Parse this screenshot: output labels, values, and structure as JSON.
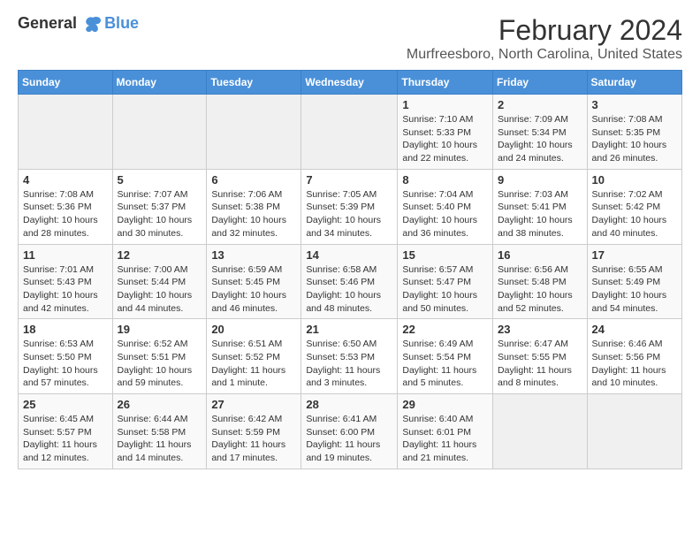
{
  "logo": {
    "line1": "General",
    "line2": "Blue"
  },
  "title": "February 2024",
  "subtitle": "Murfreesboro, North Carolina, United States",
  "days_header": [
    "Sunday",
    "Monday",
    "Tuesday",
    "Wednesday",
    "Thursday",
    "Friday",
    "Saturday"
  ],
  "weeks": [
    [
      {
        "day": "",
        "detail": ""
      },
      {
        "day": "",
        "detail": ""
      },
      {
        "day": "",
        "detail": ""
      },
      {
        "day": "",
        "detail": ""
      },
      {
        "day": "1",
        "detail": "Sunrise: 7:10 AM\nSunset: 5:33 PM\nDaylight: 10 hours\nand 22 minutes."
      },
      {
        "day": "2",
        "detail": "Sunrise: 7:09 AM\nSunset: 5:34 PM\nDaylight: 10 hours\nand 24 minutes."
      },
      {
        "day": "3",
        "detail": "Sunrise: 7:08 AM\nSunset: 5:35 PM\nDaylight: 10 hours\nand 26 minutes."
      }
    ],
    [
      {
        "day": "4",
        "detail": "Sunrise: 7:08 AM\nSunset: 5:36 PM\nDaylight: 10 hours\nand 28 minutes."
      },
      {
        "day": "5",
        "detail": "Sunrise: 7:07 AM\nSunset: 5:37 PM\nDaylight: 10 hours\nand 30 minutes."
      },
      {
        "day": "6",
        "detail": "Sunrise: 7:06 AM\nSunset: 5:38 PM\nDaylight: 10 hours\nand 32 minutes."
      },
      {
        "day": "7",
        "detail": "Sunrise: 7:05 AM\nSunset: 5:39 PM\nDaylight: 10 hours\nand 34 minutes."
      },
      {
        "day": "8",
        "detail": "Sunrise: 7:04 AM\nSunset: 5:40 PM\nDaylight: 10 hours\nand 36 minutes."
      },
      {
        "day": "9",
        "detail": "Sunrise: 7:03 AM\nSunset: 5:41 PM\nDaylight: 10 hours\nand 38 minutes."
      },
      {
        "day": "10",
        "detail": "Sunrise: 7:02 AM\nSunset: 5:42 PM\nDaylight: 10 hours\nand 40 minutes."
      }
    ],
    [
      {
        "day": "11",
        "detail": "Sunrise: 7:01 AM\nSunset: 5:43 PM\nDaylight: 10 hours\nand 42 minutes."
      },
      {
        "day": "12",
        "detail": "Sunrise: 7:00 AM\nSunset: 5:44 PM\nDaylight: 10 hours\nand 44 minutes."
      },
      {
        "day": "13",
        "detail": "Sunrise: 6:59 AM\nSunset: 5:45 PM\nDaylight: 10 hours\nand 46 minutes."
      },
      {
        "day": "14",
        "detail": "Sunrise: 6:58 AM\nSunset: 5:46 PM\nDaylight: 10 hours\nand 48 minutes."
      },
      {
        "day": "15",
        "detail": "Sunrise: 6:57 AM\nSunset: 5:47 PM\nDaylight: 10 hours\nand 50 minutes."
      },
      {
        "day": "16",
        "detail": "Sunrise: 6:56 AM\nSunset: 5:48 PM\nDaylight: 10 hours\nand 52 minutes."
      },
      {
        "day": "17",
        "detail": "Sunrise: 6:55 AM\nSunset: 5:49 PM\nDaylight: 10 hours\nand 54 minutes."
      }
    ],
    [
      {
        "day": "18",
        "detail": "Sunrise: 6:53 AM\nSunset: 5:50 PM\nDaylight: 10 hours\nand 57 minutes."
      },
      {
        "day": "19",
        "detail": "Sunrise: 6:52 AM\nSunset: 5:51 PM\nDaylight: 10 hours\nand 59 minutes."
      },
      {
        "day": "20",
        "detail": "Sunrise: 6:51 AM\nSunset: 5:52 PM\nDaylight: 11 hours\nand 1 minute."
      },
      {
        "day": "21",
        "detail": "Sunrise: 6:50 AM\nSunset: 5:53 PM\nDaylight: 11 hours\nand 3 minutes."
      },
      {
        "day": "22",
        "detail": "Sunrise: 6:49 AM\nSunset: 5:54 PM\nDaylight: 11 hours\nand 5 minutes."
      },
      {
        "day": "23",
        "detail": "Sunrise: 6:47 AM\nSunset: 5:55 PM\nDaylight: 11 hours\nand 8 minutes."
      },
      {
        "day": "24",
        "detail": "Sunrise: 6:46 AM\nSunset: 5:56 PM\nDaylight: 11 hours\nand 10 minutes."
      }
    ],
    [
      {
        "day": "25",
        "detail": "Sunrise: 6:45 AM\nSunset: 5:57 PM\nDaylight: 11 hours\nand 12 minutes."
      },
      {
        "day": "26",
        "detail": "Sunrise: 6:44 AM\nSunset: 5:58 PM\nDaylight: 11 hours\nand 14 minutes."
      },
      {
        "day": "27",
        "detail": "Sunrise: 6:42 AM\nSunset: 5:59 PM\nDaylight: 11 hours\nand 17 minutes."
      },
      {
        "day": "28",
        "detail": "Sunrise: 6:41 AM\nSunset: 6:00 PM\nDaylight: 11 hours\nand 19 minutes."
      },
      {
        "day": "29",
        "detail": "Sunrise: 6:40 AM\nSunset: 6:01 PM\nDaylight: 11 hours\nand 21 minutes."
      },
      {
        "day": "",
        "detail": ""
      },
      {
        "day": "",
        "detail": ""
      }
    ]
  ]
}
